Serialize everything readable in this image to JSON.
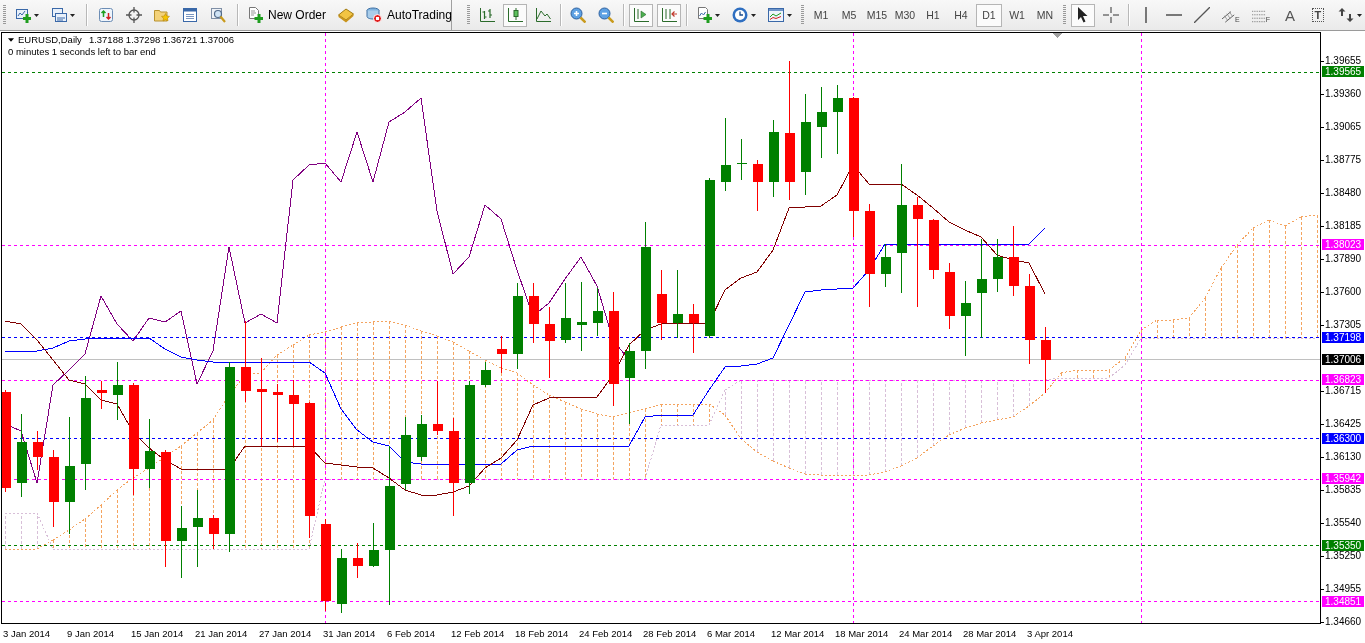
{
  "toolbars": [
    {
      "groups": [
        [
          {
            "kind": "new-chart",
            "dropdown": true
          },
          {
            "kind": "profiles",
            "dropdown": true
          }
        ],
        [
          {
            "kind": "market-watch"
          },
          {
            "kind": "data-window"
          },
          {
            "kind": "navigator"
          },
          {
            "kind": "terminal"
          },
          {
            "kind": "strategy-tester"
          }
        ],
        [
          {
            "kind": "new-order",
            "label": "New Order"
          },
          {
            "kind": "meta-editor"
          },
          {
            "kind": "auto-trading",
            "label": "AutoTrading"
          }
        ]
      ]
    },
    {
      "groups": [
        [
          {
            "kind": "bar-chart",
            "selected": false
          },
          {
            "kind": "candle-chart",
            "selected": true
          },
          {
            "kind": "line-chart",
            "selected": false
          }
        ],
        [
          {
            "kind": "zoom-in"
          },
          {
            "kind": "zoom-out"
          }
        ],
        [
          {
            "kind": "auto-scroll",
            "selected": true
          },
          {
            "kind": "chart-shift",
            "selected": true
          }
        ],
        [
          {
            "kind": "indicators",
            "dropdown": true
          },
          {
            "kind": "periods",
            "dropdown": true
          },
          {
            "kind": "templates",
            "dropdown": true
          }
        ]
      ]
    },
    {
      "groups": [
        [
          {
            "kind": "timeframe",
            "label": "M1",
            "selected": false
          },
          {
            "kind": "timeframe",
            "label": "M5",
            "selected": false
          },
          {
            "kind": "timeframe",
            "label": "M15",
            "selected": false
          },
          {
            "kind": "timeframe",
            "label": "M30",
            "selected": false
          },
          {
            "kind": "timeframe",
            "label": "H1",
            "selected": false
          },
          {
            "kind": "timeframe",
            "label": "H4",
            "selected": false
          },
          {
            "kind": "timeframe",
            "label": "D1",
            "selected": true
          },
          {
            "kind": "timeframe",
            "label": "W1",
            "selected": false
          },
          {
            "kind": "timeframe",
            "label": "MN",
            "selected": false
          }
        ]
      ]
    },
    {
      "groups": [
        [
          {
            "kind": "cursor",
            "selected": true
          },
          {
            "kind": "crosshair",
            "selected": false
          }
        ],
        [
          {
            "kind": "vertical-line",
            "dropdown": false
          },
          {
            "kind": "horizontal-line",
            "dropdown": false
          },
          {
            "kind": "trendline",
            "dropdown": false
          },
          {
            "kind": "channel",
            "label": "E",
            "dropdown": false
          },
          {
            "kind": "fibonacci",
            "label": "F",
            "dropdown": false
          },
          {
            "kind": "text",
            "label": "A",
            "dropdown": false
          },
          {
            "kind": "text-label",
            "label": "T",
            "dropdown": false
          },
          {
            "kind": "arrows",
            "dropdown": true
          }
        ]
      ]
    }
  ],
  "chart": {
    "symbol": "EURUSD,Daily",
    "quote": "1.37188 1.37298 1.36721 1.37006",
    "countdown": "0 minutes 1 seconds left to bar end",
    "price_ticks": [
      "1.39655",
      "1.39360",
      "1.39065",
      "1.38775",
      "1.38480",
      "1.38185",
      "1.37890",
      "1.37600",
      "1.37305",
      "1.36715",
      "1.36425",
      "1.36130",
      "1.35835",
      "1.35540",
      "1.35250",
      "1.34955",
      "1.34660"
    ],
    "price_tags": [
      {
        "label": "1.39565",
        "color": "#008000",
        "kind": "level"
      },
      {
        "label": "1.38023",
        "color": "#ff00ff",
        "kind": "level"
      },
      {
        "label": "1.37198",
        "color": "#0000ff",
        "kind": "level"
      },
      {
        "label": "1.37006",
        "color": "#000000",
        "kind": "bid"
      },
      {
        "label": "1.36823",
        "color": "#ff00ff",
        "kind": "level"
      },
      {
        "label": "1.36300",
        "color": "#0000ff",
        "kind": "level"
      },
      {
        "label": "1.35942",
        "color": "#ff00ff",
        "kind": "level"
      },
      {
        "label": "1.35350",
        "color": "#008000",
        "kind": "level"
      },
      {
        "label": "1.34851",
        "color": "#ff00ff",
        "kind": "level"
      }
    ],
    "time_labels": [
      "3 Jan 2014",
      "9 Jan 2014",
      "15 Jan 2014",
      "21 Jan 2014",
      "27 Jan 2014",
      "31 Jan 2014",
      "6 Feb 2014",
      "12 Feb 2014",
      "18 Feb 2014",
      "24 Feb 2014",
      "28 Feb 2014",
      "6 Mar 2014",
      "12 Mar 2014",
      "18 Mar 2014",
      "24 Mar 2014",
      "28 Mar 2014",
      "3 Apr 2014"
    ]
  }
}
